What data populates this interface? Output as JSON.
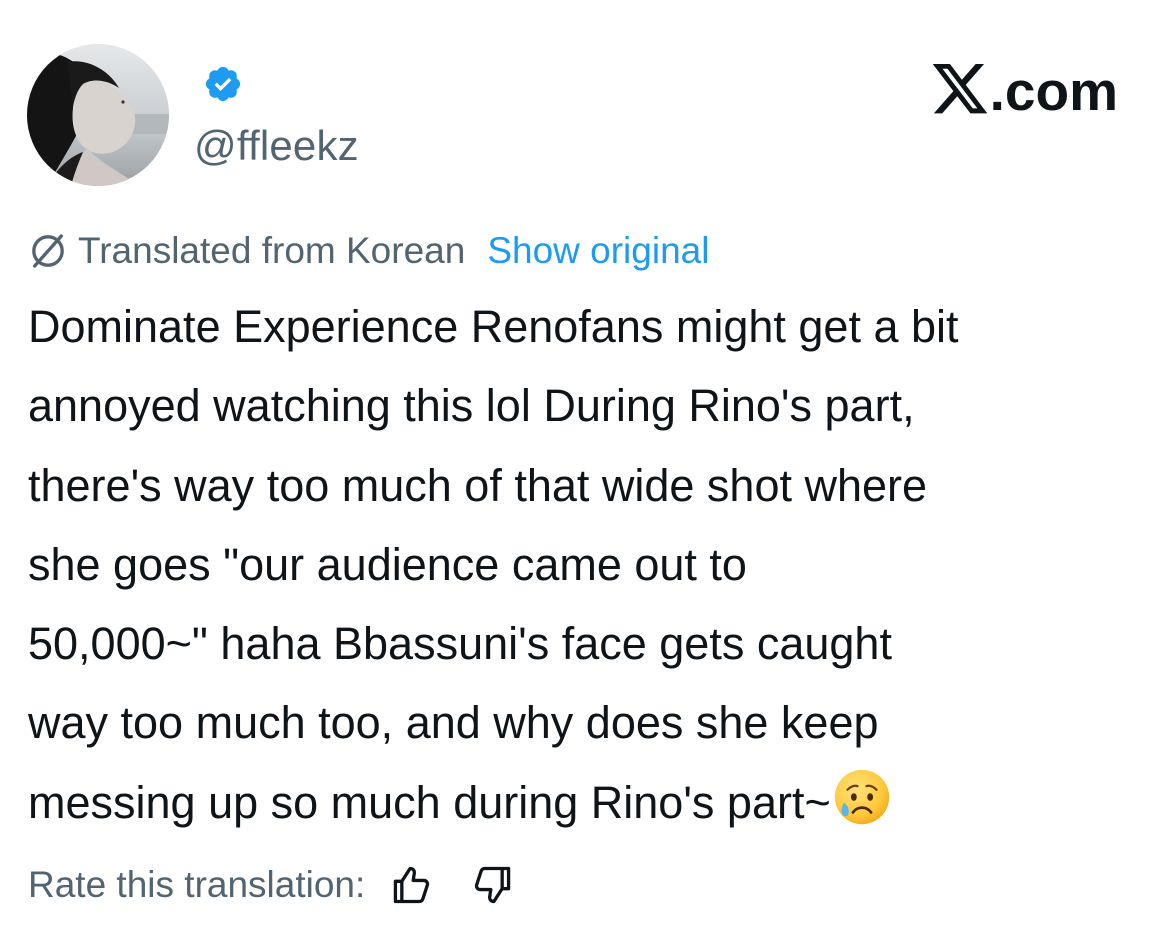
{
  "header": {
    "handle": "@ffleekz",
    "verified": true,
    "brand": ".com",
    "brand_icon": "x-logo-icon"
  },
  "translation": {
    "label": "Translated from Korean",
    "show_original": "Show original",
    "icon": "translate-icon"
  },
  "tweet": {
    "lines": [
      "Dominate Experience Renofans might get a bit",
      "annoyed watching this lol During Rino's part,",
      "there's way too much of that wide shot where",
      "she goes \"our audience came out to",
      "50,000~\" haha Bbassuni's face gets caught",
      "way too much too, and why does she keep",
      "messing up so much during Rino's part~"
    ],
    "trailing_emoji": "sad-but-relieved-face-emoji"
  },
  "rating": {
    "label": "Rate this translation:",
    "up_icon": "thumbs-up-icon",
    "down_icon": "thumbs-down-icon"
  },
  "colors": {
    "text_primary": "#0f1419",
    "text_secondary": "#536471",
    "link": "#1d9bf0",
    "verified": "#1d9bf0"
  }
}
